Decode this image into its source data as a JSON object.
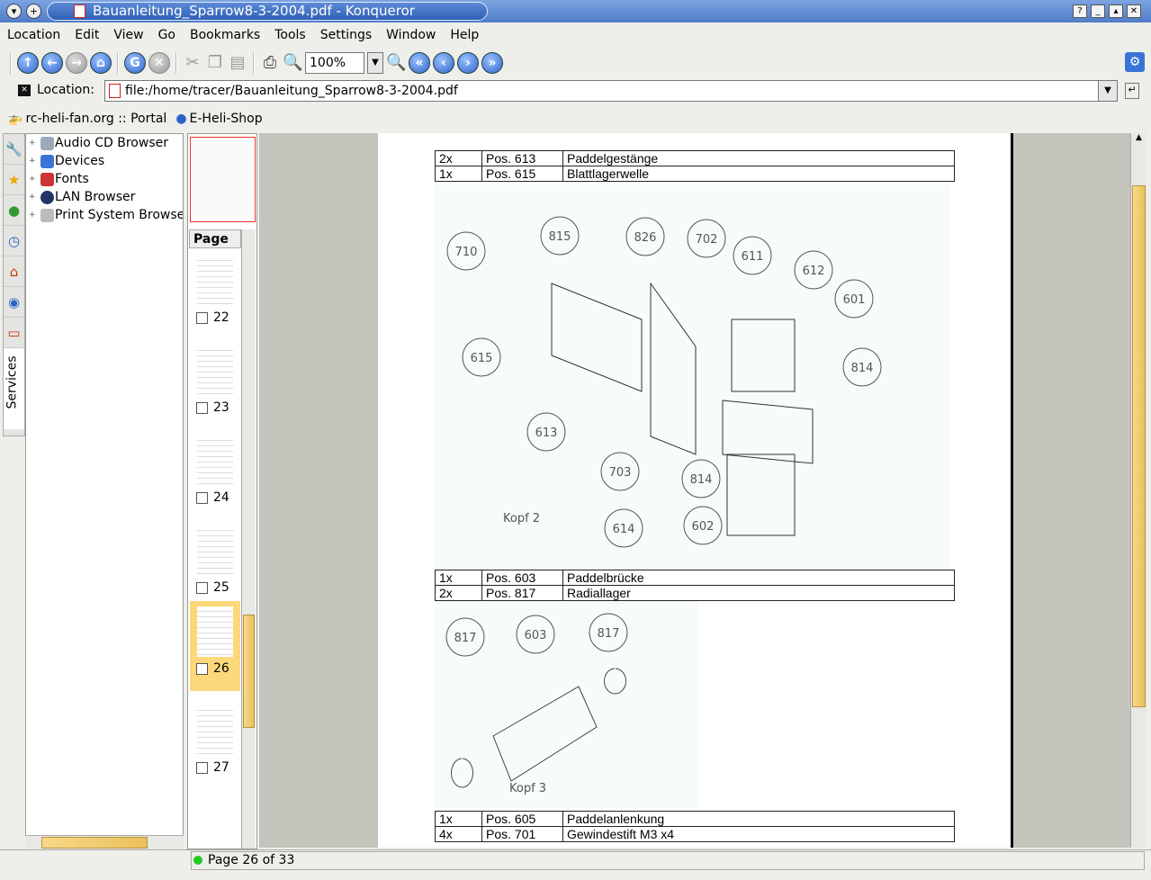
{
  "window": {
    "title": "Bauanleitung_Sparrow8-3-2004.pdf - Konqueror"
  },
  "menu": [
    "Location",
    "Edit",
    "View",
    "Go",
    "Bookmarks",
    "Tools",
    "Settings",
    "Window",
    "Help"
  ],
  "toolbar": {
    "zoom_value": "100%"
  },
  "location": {
    "label": "Location:",
    "url": "file:/home/tracer/Bauanleitung_Sparrow8-3-2004.pdf"
  },
  "bookmarks": [
    "rc-heli-fan.org :: Portal",
    "E-Heli-Shop"
  ],
  "sidebar": {
    "tabs": [
      "Services"
    ],
    "tree": [
      "Audio CD Browser",
      "Devices",
      "Fonts",
      "LAN Browser",
      "Print System Browser"
    ]
  },
  "thumbnails": {
    "header": "Page",
    "pages": [
      "22",
      "23",
      "24",
      "25",
      "26",
      "27"
    ],
    "selected": "26"
  },
  "document": {
    "table1": [
      [
        "2x",
        "Pos. 613",
        "Paddelgestänge"
      ],
      [
        "1x",
        "Pos. 615",
        "Blattlagerwelle"
      ]
    ],
    "diagram1": {
      "caption": "Kopf 2",
      "labels": [
        "710",
        "815",
        "826",
        "702",
        "611",
        "612",
        "601",
        "615",
        "814",
        "613",
        "703",
        "814",
        "614",
        "602"
      ]
    },
    "table2": [
      [
        "1x",
        "Pos. 603",
        "Paddelbrücke"
      ],
      [
        "2x",
        "Pos. 817",
        "Radiallager"
      ]
    ],
    "diagram2": {
      "caption": "Kopf 3",
      "labels": [
        "817",
        "603",
        "817"
      ]
    },
    "table3": [
      [
        "1x",
        "Pos. 605",
        "Paddelanlenkung"
      ],
      [
        "4x",
        "Pos. 701",
        "Gewindestift M3 x4"
      ]
    ]
  },
  "status": {
    "text": "Page 26 of 33"
  },
  "colors": {
    "accent": "#4f7cc8",
    "selection": "#fcd87a"
  }
}
